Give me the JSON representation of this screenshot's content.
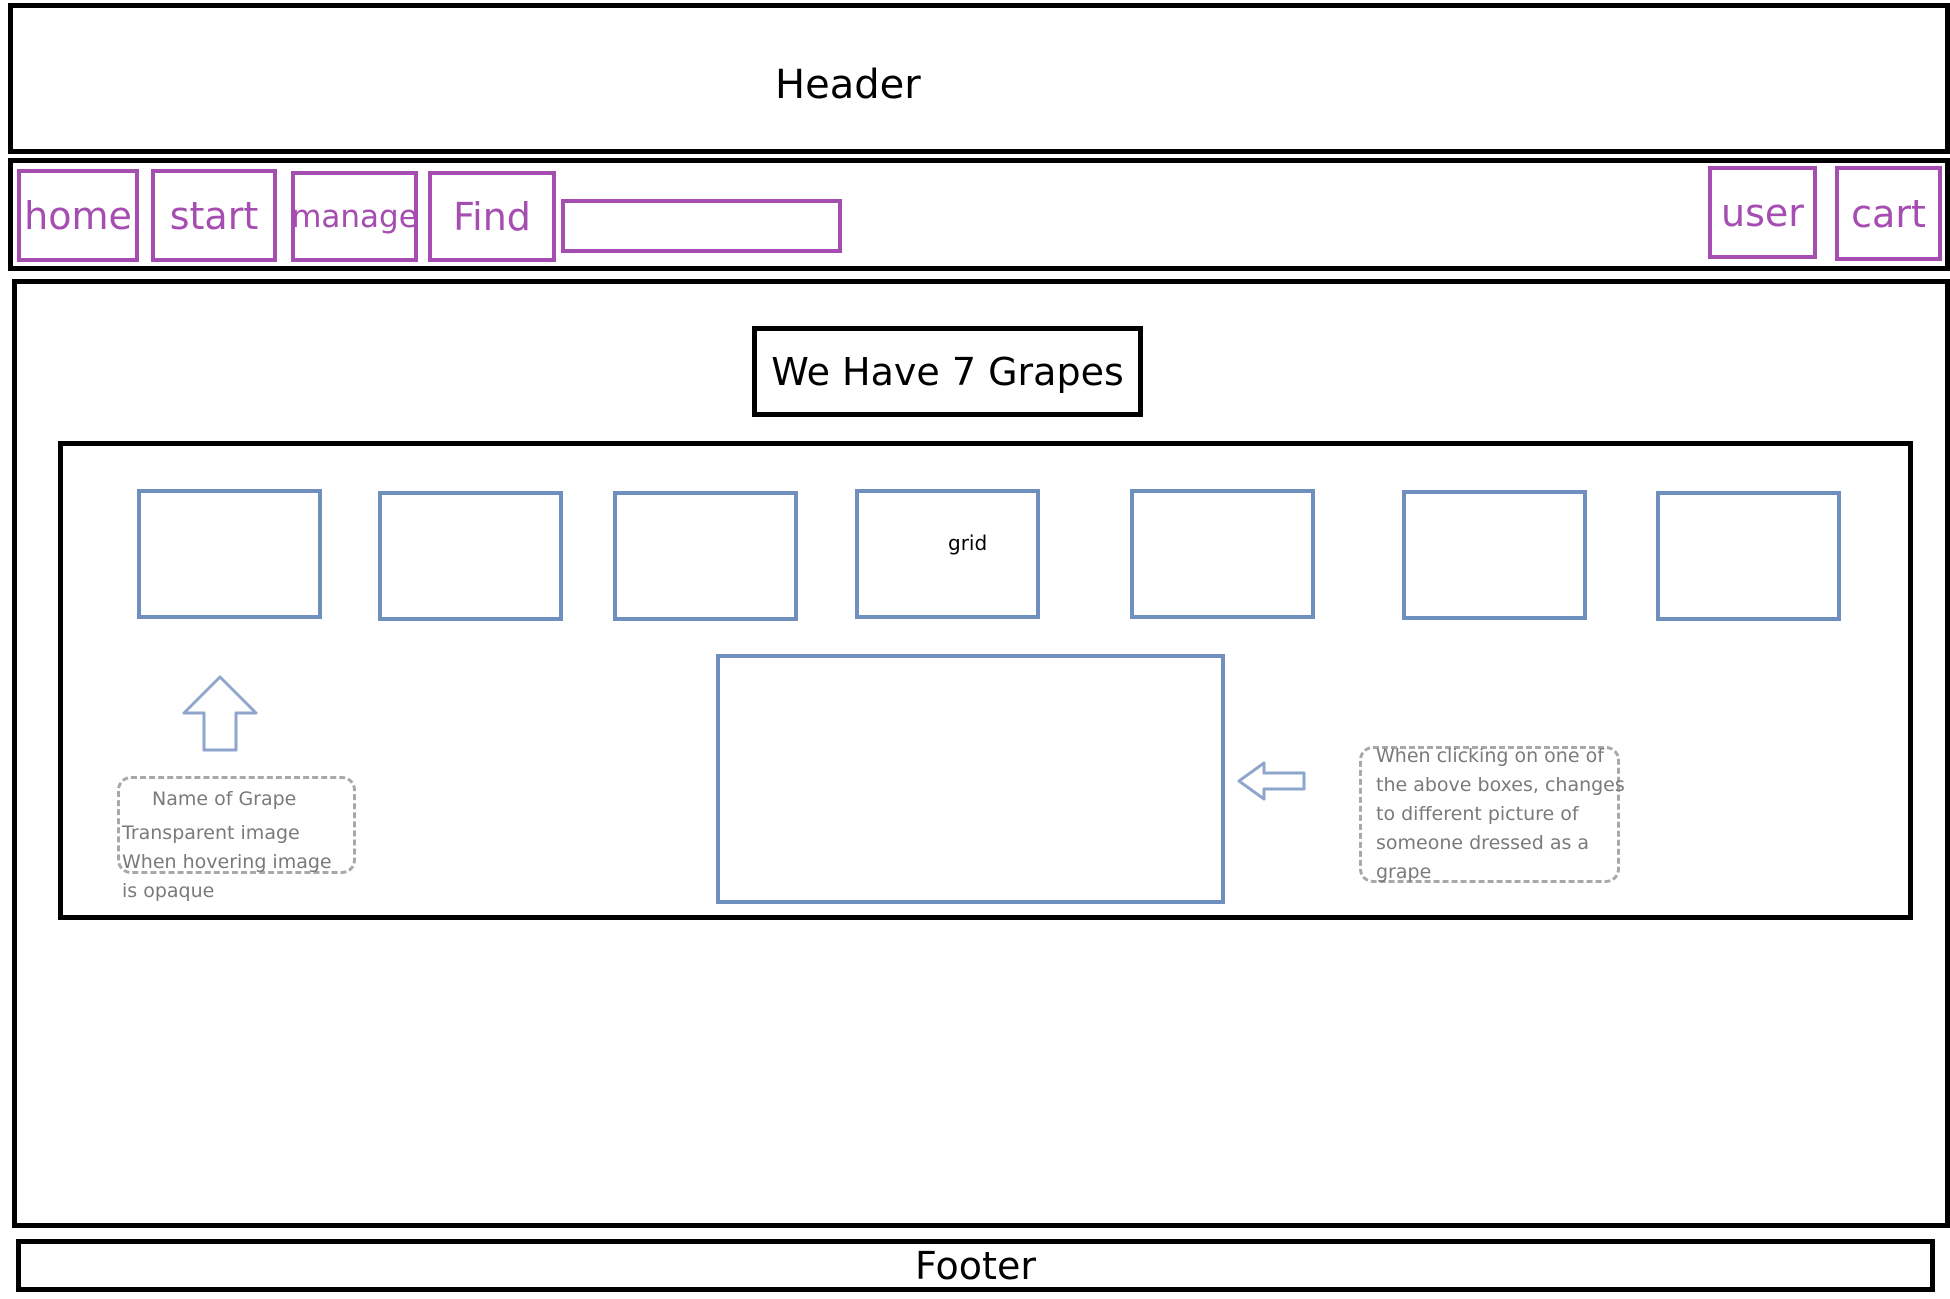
{
  "header": {
    "title": "Header"
  },
  "nav": {
    "home": "home",
    "start": "start",
    "manage": "manage",
    "find": "Find",
    "search_value": "",
    "user": "user",
    "cart": "cart"
  },
  "main": {
    "title": "We Have 7 Grapes",
    "grid_label": "grid",
    "notes": {
      "thumbnail": {
        "line1": "Name of Grape",
        "line2": "Transparent image",
        "line3": "When hovering image",
        "line4": "is opaque"
      },
      "preview": {
        "line1": "When clicking on one of",
        "line2": "the above boxes, changes",
        "line3": "to different picture of",
        "line4": "someone dressed as a",
        "line5": "grape"
      }
    }
  },
  "footer": {
    "title": "Footer"
  },
  "colors": {
    "nav_accent": "#a64db1",
    "image_box": "#6f8fbf",
    "note_text": "#7a7a7a"
  },
  "icons": [
    "up-arrow-icon",
    "left-arrow-icon"
  ]
}
